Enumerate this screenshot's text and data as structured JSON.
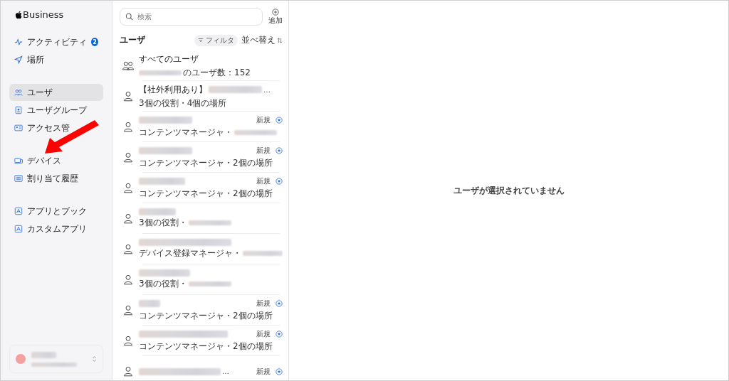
{
  "sidebar": {
    "logo": "Business",
    "sections": [
      [
        {
          "label": "アクティビティ",
          "badge": "2",
          "selected": false
        },
        {
          "label": "場所",
          "selected": false
        }
      ],
      [
        {
          "label": "ユーザ",
          "selected": true
        },
        {
          "label": "ユーザグループ",
          "selected": false
        },
        {
          "label": "アクセス管",
          "selected": false
        }
      ],
      [
        {
          "label": "デバイス",
          "selected": false
        },
        {
          "label": "割り当て履歴",
          "selected": false
        }
      ],
      [
        {
          "label": "アプリとブック",
          "selected": false
        },
        {
          "label": "カスタムアプリ",
          "selected": false
        }
      ]
    ]
  },
  "list": {
    "search": {
      "placeholder": "検索"
    },
    "add": "追加",
    "title": "ユーザ",
    "filter": "フィルタ",
    "sort": "並べ替え",
    "items": [
      {
        "kind": "group",
        "name": "すべてのユーザ",
        "sub_blur_before": true,
        "subtitle": "のユーザ数：152"
      },
      {
        "kind": "person",
        "name": "【社外利用あり】",
        "name_blur": true,
        "name_suffix": "…",
        "subtitle": "3個の役割・4個の場所"
      },
      {
        "kind": "person",
        "name_blur": true,
        "sub_blur_after": true,
        "subtitle": "コンテンツマネージャ・",
        "badge": "新規"
      },
      {
        "kind": "person",
        "name_blur": true,
        "subtitle": "コンテンツマネージャ・2個の場所",
        "badge": "新規"
      },
      {
        "kind": "person",
        "name_blur": true,
        "subtitle": "コンテンツマネージャ・2個の場所",
        "badge": "新規"
      },
      {
        "kind": "person",
        "name_blur": true,
        "sub_blur_after": true,
        "subtitle": "3個の役割・"
      },
      {
        "kind": "person",
        "name_blur": true,
        "sub_blur_after": true,
        "subtitle": "デバイス登録マネージャ・"
      },
      {
        "kind": "person",
        "name_blur": true,
        "sub_blur_after": true,
        "subtitle": "3個の役割・"
      },
      {
        "kind": "person",
        "name_blur": true,
        "subtitle": "コンテンツマネージャ・2個の場所",
        "badge": "新規"
      },
      {
        "kind": "person",
        "name_blur": true,
        "subtitle": "コンテンツマネージャ・2個の場所",
        "badge": "新規"
      },
      {
        "kind": "person",
        "name_blur": true,
        "name_suffix": "…",
        "badge": "新規"
      }
    ]
  },
  "detail": {
    "empty_message": "ユーザが選択されていません"
  }
}
